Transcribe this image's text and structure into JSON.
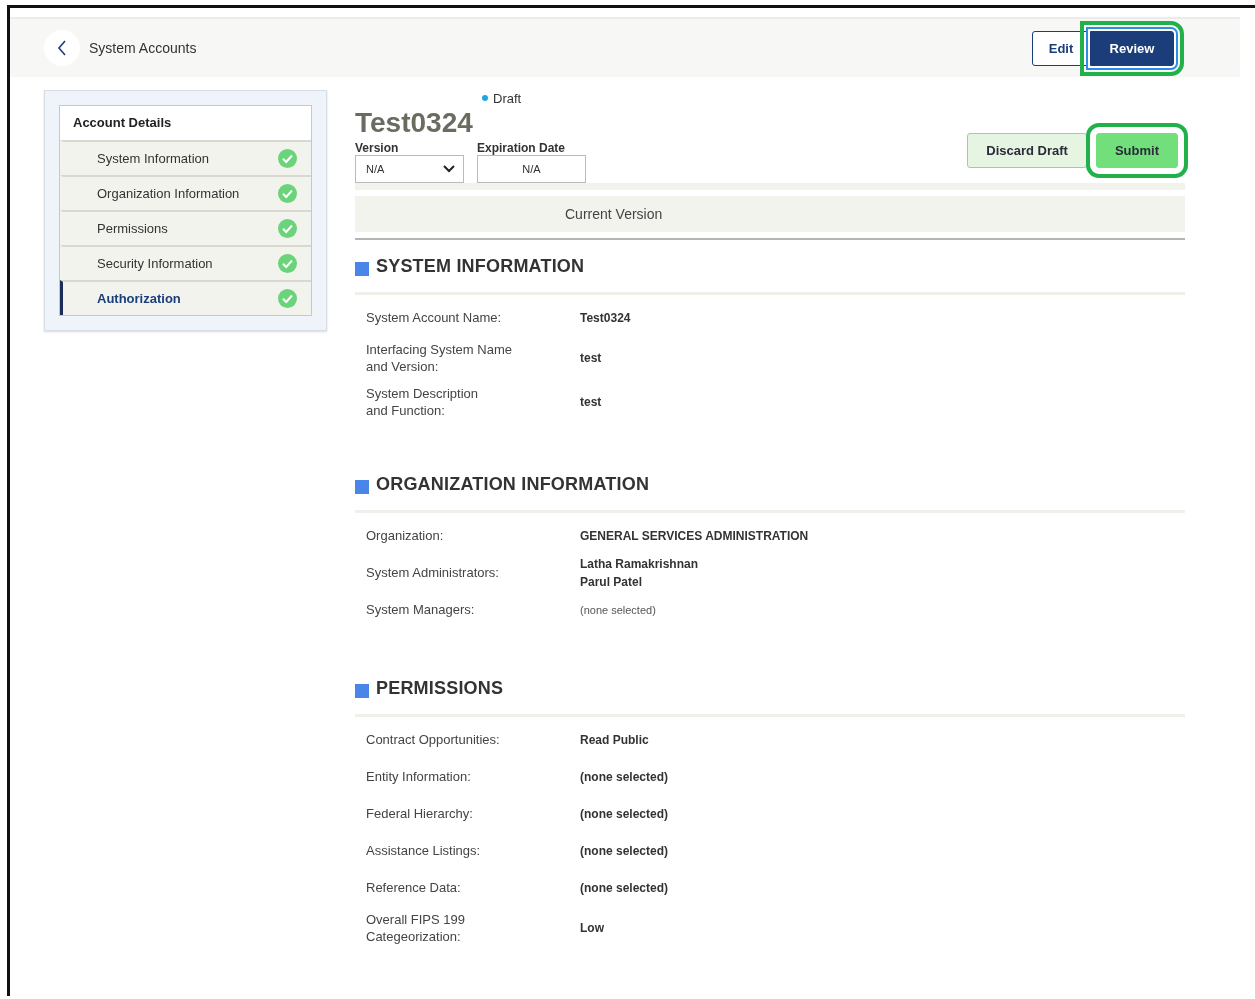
{
  "header": {
    "title": "System Accounts",
    "buttons": [
      {
        "label": "Edit",
        "kind": "outline",
        "highlighted": false
      },
      {
        "label": "Review",
        "kind": "primary",
        "highlighted": true
      }
    ]
  },
  "sidebar": {
    "title": "Account Details",
    "items": [
      {
        "label": "System Information",
        "selected": false,
        "complete": true
      },
      {
        "label": "Organization Information",
        "selected": false,
        "complete": true
      },
      {
        "label": "Permissions",
        "selected": false,
        "complete": true
      },
      {
        "label": "Security Information",
        "selected": false,
        "complete": true
      },
      {
        "label": "Authorization",
        "selected": true,
        "complete": true
      }
    ]
  },
  "record": {
    "status": "Draft",
    "title": "Test0324",
    "version": {
      "label": "Version",
      "value": "N/A"
    },
    "expiration": {
      "label": "Expiration Date",
      "value": "N/A"
    },
    "actions": [
      {
        "label": "Discard Draft",
        "kind": "secondary",
        "highlighted": false
      },
      {
        "label": "Submit",
        "kind": "success",
        "highlighted": true
      }
    ],
    "version_tab": "Current Version"
  },
  "sections": [
    {
      "title": "SYSTEM INFORMATION",
      "rows": [
        {
          "label": "System Account Name:",
          "values": [
            "Test0324"
          ],
          "muted": false
        },
        {
          "label": "Interfacing System Name\nand Version:",
          "values": [
            "test"
          ],
          "muted": false
        },
        {
          "label": "System Description\nand Function:",
          "values": [
            "test"
          ],
          "muted": false
        }
      ]
    },
    {
      "title": "ORGANIZATION INFORMATION",
      "rows": [
        {
          "label": "Organization:",
          "values": [
            "GENERAL SERVICES ADMINISTRATION"
          ],
          "muted": false
        },
        {
          "label": "System Administrators:",
          "values": [
            "Latha Ramakrishnan",
            "Parul Patel"
          ],
          "muted": false
        },
        {
          "label": "System Managers:",
          "values": [
            "(none selected)"
          ],
          "muted": true
        }
      ]
    },
    {
      "title": "PERMISSIONS",
      "rows": [
        {
          "label": "Contract Opportunities:",
          "values": [
            "Read Public"
          ],
          "muted": false
        },
        {
          "label": "Entity Information:",
          "values": [
            "(none selected)"
          ],
          "muted": false
        },
        {
          "label": "Federal Hierarchy:",
          "values": [
            "(none selected)"
          ],
          "muted": false
        },
        {
          "label": "Assistance Listings:",
          "values": [
            "(none selected)"
          ],
          "muted": false
        },
        {
          "label": "Reference Data:",
          "values": [
            "(none selected)"
          ],
          "muted": false
        },
        {
          "label": "Overall FIPS 199\nCategeorization:",
          "values": [
            "Low"
          ],
          "muted": false
        }
      ]
    }
  ]
}
